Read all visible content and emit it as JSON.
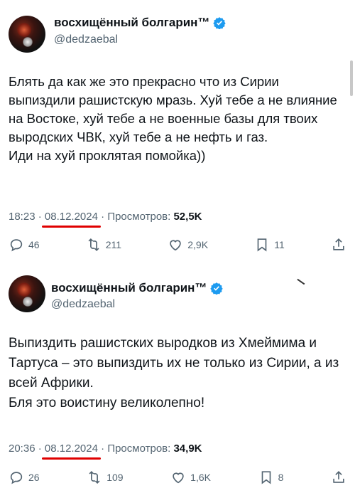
{
  "tweets": [
    {
      "name": "восхищённый болгарин™",
      "handle": "@dedzaebal",
      "text_lines": [
        "Блять да как же это прекрасно что из Сирии выпиздили рашистскую мразь. Хуй тебе а не влияние на Востоке, хуй тебе а не военные базы для твоих выродских ЧВК, хуй тебе а не нефть и газ.",
        "Иди на хуй проклятая помойка))"
      ],
      "time": "18:23",
      "date": "08.12.2024",
      "views_label": "Просмотров:",
      "views_count": "52,5K",
      "replies": "46",
      "retweets": "211",
      "likes": "2,9K",
      "bookmarks": "11"
    },
    {
      "name": "восхищённый болгарин™",
      "handle": "@dedzaebal",
      "text_lines": [
        "Выпиздить рашистских выродков из Хмеймима и Тартуса – это выпиздить их не только из Сирии, а из всей Африки.",
        "Бля это воистину великолепно!"
      ],
      "time": "20:36",
      "date": "08.12.2024",
      "views_label": "Просмотров:",
      "views_count": "34,9K",
      "replies": "26",
      "retweets": "109",
      "likes": "1,6K",
      "bookmarks": "8"
    }
  ],
  "icons": {
    "verified": "verified-badge-icon",
    "reply": "reply-icon",
    "retweet": "retweet-icon",
    "like": "heart-icon",
    "bookmark": "bookmark-icon",
    "share": "share-icon"
  },
  "colors": {
    "verified_blue": "#1d9bf0",
    "underline_red": "#e00000",
    "muted_text": "#536471",
    "text": "#0f1419"
  }
}
